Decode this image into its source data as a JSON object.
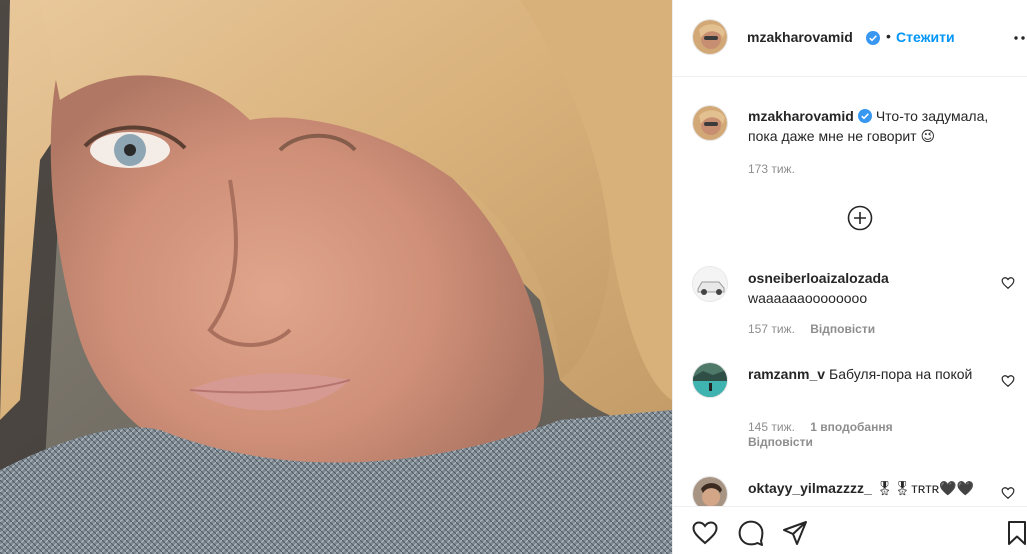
{
  "post": {
    "author": "mzakharovamid",
    "follow_label": "Стежити",
    "separator": "•",
    "caption_text": "Что-то задумала, пока даже мне не говорит 😉",
    "caption_time": "173 тиж."
  },
  "comments": [
    {
      "username": "osneiberloaizalozada",
      "text": "waaaaaaoooooooo",
      "time": "157 тиж.",
      "reply_label": "Відповісти"
    },
    {
      "username": "ramzanm_v",
      "text": "Бабуля-пора на покой",
      "time": "145 тиж.",
      "likes": "1 вподобання",
      "reply_label": "Відповісти"
    },
    {
      "username": "oktayy_yilmazzzz_",
      "text": "🎖🎖ᴛʀᴛʀ🖤🖤"
    }
  ],
  "colors": {
    "accent": "#0095f6",
    "verified": "#3897f0",
    "muted": "#8e8e8e",
    "border": "#efefef"
  },
  "icons": {
    "load_more": "plus-circle-icon",
    "like": "heart-icon",
    "comment": "comment-bubble-icon",
    "share": "paper-plane-icon",
    "save": "bookmark-icon",
    "more": "ellipsis-icon"
  }
}
